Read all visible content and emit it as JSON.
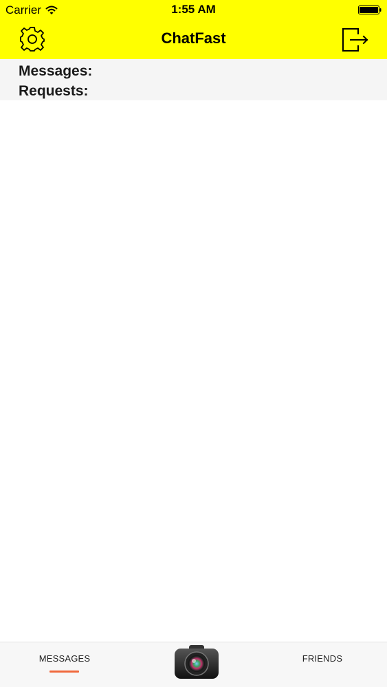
{
  "status_bar": {
    "carrier": "Carrier",
    "time": "1:55 AM"
  },
  "nav": {
    "title": "ChatFast",
    "left_icon": "gear-icon",
    "right_icon": "logout-icon"
  },
  "summary": {
    "messages_label": "Messages:",
    "requests_label": "Requests:"
  },
  "tabs": [
    {
      "label": "MESSAGES",
      "selected": true
    },
    {
      "label": "FRIENDS",
      "selected": false
    }
  ],
  "camera_icon": "camera-icon",
  "colors": {
    "header_bg": "#ffff00",
    "accent": "#f0683c",
    "summary_bg": "#f5f5f5",
    "tabbar_bg": "#f7f7f7"
  }
}
